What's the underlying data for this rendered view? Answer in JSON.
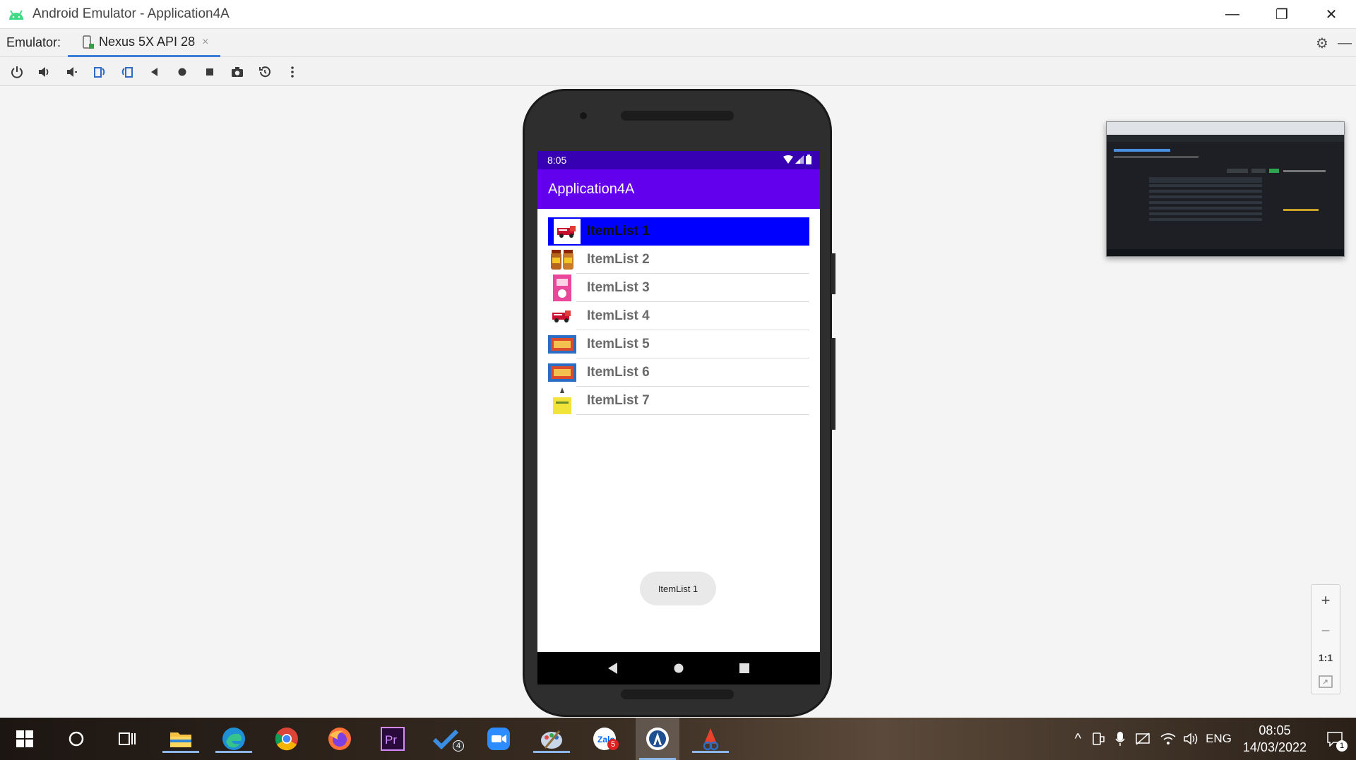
{
  "window": {
    "title": "Android Emulator - Application4A",
    "minimize_symbol": "—",
    "restore_symbol": "❐",
    "close_symbol": "✕"
  },
  "tabbar": {
    "label": "Emulator:",
    "tab_name": "Nexus 5X API 28",
    "close_symbol": "×"
  },
  "toolbar": {
    "buttons": [
      "power-icon",
      "volume-up-icon",
      "volume-down-icon",
      "rotate-left-icon",
      "rotate-right-icon",
      "back-icon",
      "home-icon",
      "overview-icon",
      "screenshot-icon",
      "snapshot-icon",
      "more-icon"
    ]
  },
  "device": {
    "status_time": "8:05",
    "app_title": "Application4A",
    "items": [
      {
        "label": "ItemList 1",
        "selected": true,
        "thumb": "fire-truck"
      },
      {
        "label": "ItemList 2",
        "selected": false,
        "thumb": "jars"
      },
      {
        "label": "ItemList 3",
        "selected": false,
        "thumb": "pink-book"
      },
      {
        "label": "ItemList 4",
        "selected": false,
        "thumb": "fire-truck"
      },
      {
        "label": "ItemList 5",
        "selected": false,
        "thumb": "toy-box"
      },
      {
        "label": "ItemList 6",
        "selected": false,
        "thumb": "toy-box"
      },
      {
        "label": "ItemList 7",
        "selected": false,
        "thumb": "yellow-book"
      }
    ],
    "toast": "ItemList 1"
  },
  "zoom": {
    "zoom_in": "+",
    "zoom_out": "−",
    "actual_size": "1:1"
  },
  "taskbar": {
    "badges": {
      "todo": "4",
      "zalo": "5",
      "notifications": "1"
    },
    "tray_lang": "ENG",
    "clock_time": "08:05",
    "clock_date": "14/03/2022"
  }
}
